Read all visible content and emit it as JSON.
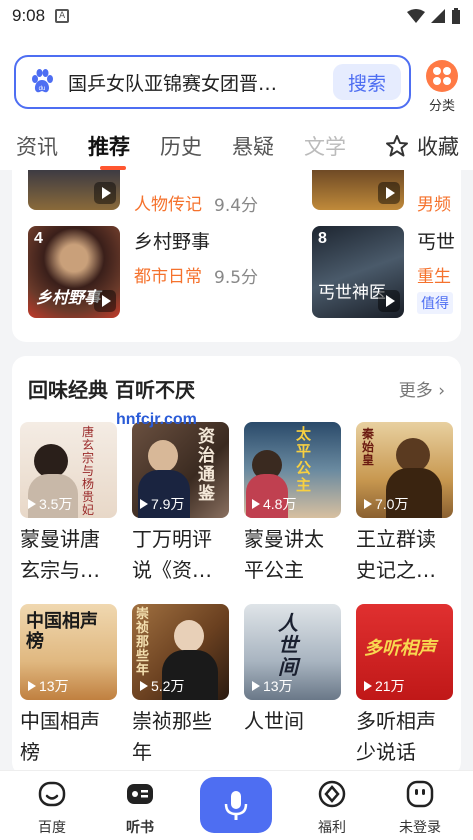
{
  "status_bar": {
    "time": "9:08"
  },
  "search": {
    "query": "国乒女队亚锦赛女团晋…",
    "button_label": "搜索"
  },
  "category": {
    "label": "分类"
  },
  "tabs": [
    {
      "label": "资讯"
    },
    {
      "label": "推荐",
      "active": true
    },
    {
      "label": "历史"
    },
    {
      "label": "悬疑"
    },
    {
      "label": "文学"
    }
  ],
  "favorite": {
    "label": "收藏"
  },
  "ranking": {
    "row1": [
      {
        "tag": "人物传记",
        "score": "9.4分"
      },
      {
        "tag": "男频"
      }
    ],
    "row2": [
      {
        "rank": "4",
        "title": "乡村野事",
        "tag": "都市日常",
        "score": "9.5分",
        "cover_text": "乡村野事"
      },
      {
        "rank": "8",
        "title": "丐世",
        "tag": "重生",
        "extra": "值得",
        "cover_text": "丐世神医"
      }
    ]
  },
  "classics": {
    "title": "回味经典 百听不厌",
    "more_label": "更多",
    "watermark": "hnfcjr.com",
    "items": [
      {
        "name_line1": "蒙曼讲唐",
        "name_line2": "玄宗与…",
        "count": "3.5万",
        "cover_text": "唐玄宗与杨贵妃"
      },
      {
        "name_line1": "丁万明评",
        "name_line2": "说《资…",
        "count": "7.9万",
        "cover_text": "资治通鉴"
      },
      {
        "name_line1": "蒙曼讲太",
        "name_line2": "平公主",
        "count": "4.8万",
        "cover_text": "太平公主"
      },
      {
        "name_line1": "王立群读",
        "name_line2": "史记之…",
        "count": "7.0万",
        "cover_text": "秦始皇"
      },
      {
        "name_line1": "中国相声",
        "name_line2": "榜",
        "count": "13万",
        "cover_text": "中国相声榜"
      },
      {
        "name_line1": "崇祯那些",
        "name_line2": "年",
        "count": "5.2万",
        "cover_text": "崇祯那些年"
      },
      {
        "name_line1": "人世间",
        "name_line2": "",
        "count": "13万",
        "cover_text": "人世间"
      },
      {
        "name_line1": "多听相声",
        "name_line2": "少说话",
        "count": "21万",
        "cover_text": "多听相声"
      }
    ]
  },
  "bottom_nav": [
    {
      "label": "百度"
    },
    {
      "label": "听书",
      "active": true
    },
    {
      "label": "福利"
    },
    {
      "label": "未登录"
    }
  ],
  "colors": {
    "accent": "#4e6ef2",
    "tag": "#f5722d",
    "tab_indicator": "#ff5630"
  }
}
